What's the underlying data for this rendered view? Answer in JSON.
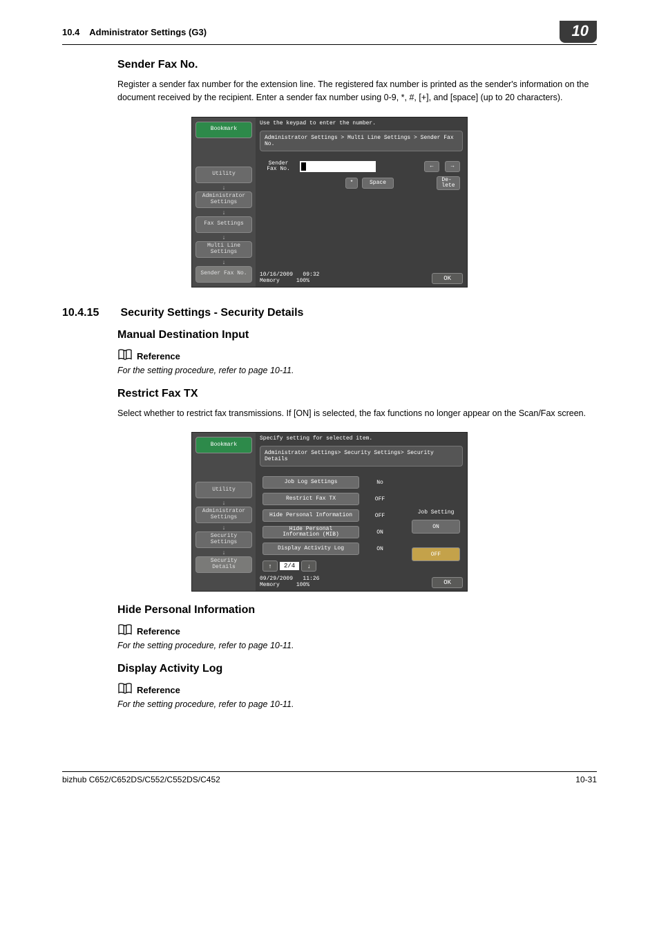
{
  "header": {
    "section_num": "10.4",
    "section_title": "Administrator Settings (G3)",
    "chapter_badge": "10"
  },
  "s1": {
    "title": "Sender Fax No.",
    "para": "Register a sender fax number for the extension line. The registered fax number is printed as the sender's information on the document received by the recipient. Enter a sender fax number using 0-9, *, #, [+], and [space] (up to 20 characters)."
  },
  "shot1": {
    "instruction": "Use the keypad to enter the number.",
    "breadcrumb": "Administrator Settings > Multi Line Settings > Sender Fax No.",
    "side": {
      "bookmark": "Bookmark",
      "utility": "Utility",
      "admin": "Administrator\nSettings",
      "fax": "Fax Settings",
      "multi": "Multi Line\nSettings",
      "sender": "Sender Fax No."
    },
    "field_label": "Sender\nFax No.",
    "btn_left": "←",
    "btn_right": "→",
    "btn_star": "*",
    "btn_space": "Space",
    "btn_delete": "De-\nlete",
    "footer_date": "10/16/2009",
    "footer_time": "09:32",
    "footer_mem": "Memory",
    "footer_pct": "100%",
    "ok": "OK"
  },
  "s2": {
    "num": "10.4.15",
    "title": "Security Settings - Security Details"
  },
  "s3": {
    "title": "Manual Destination Input",
    "ref_label": "Reference",
    "ref_text": "For the setting procedure, refer to page 10-11."
  },
  "s4": {
    "title": "Restrict Fax TX",
    "para": "Select whether to restrict fax transmissions. If [ON] is selected, the fax functions no longer appear on the Scan/Fax screen."
  },
  "shot2": {
    "instruction": "Specify setting for selected item.",
    "breadcrumb": "Administrator Settings> Security Settings> Security Details",
    "side": {
      "bookmark": "Bookmark",
      "utility": "Utility",
      "admin": "Administrator\nSettings",
      "sec": "Security\nSettings",
      "secd": "Security Details"
    },
    "rows": {
      "r1l": "Job Log Settings",
      "r1v": "No",
      "r2l": "Restrict Fax TX",
      "r2v": "OFF",
      "r3l": "Hide Personal Information",
      "r3v": "OFF",
      "r4l": "Hide Personal\nInformation (MIB)",
      "r4v": "ON",
      "r5l": "Display Activity Log",
      "r5v": "ON"
    },
    "right_title": "Job Setting",
    "choice_on": "ON",
    "choice_off": "OFF",
    "pager": "2/4",
    "footer_date": "09/29/2009",
    "footer_time": "11:26",
    "footer_mem": "Memory",
    "footer_pct": "100%",
    "ok": "OK"
  },
  "s5": {
    "title": "Hide Personal Information",
    "ref_label": "Reference",
    "ref_text": "For the setting procedure, refer to page 10-11."
  },
  "s6": {
    "title": "Display Activity Log",
    "ref_label": "Reference",
    "ref_text": "For the setting procedure, refer to page 10-11."
  },
  "footer": {
    "left": "bizhub C652/C652DS/C552/C552DS/C452",
    "right": "10-31"
  }
}
